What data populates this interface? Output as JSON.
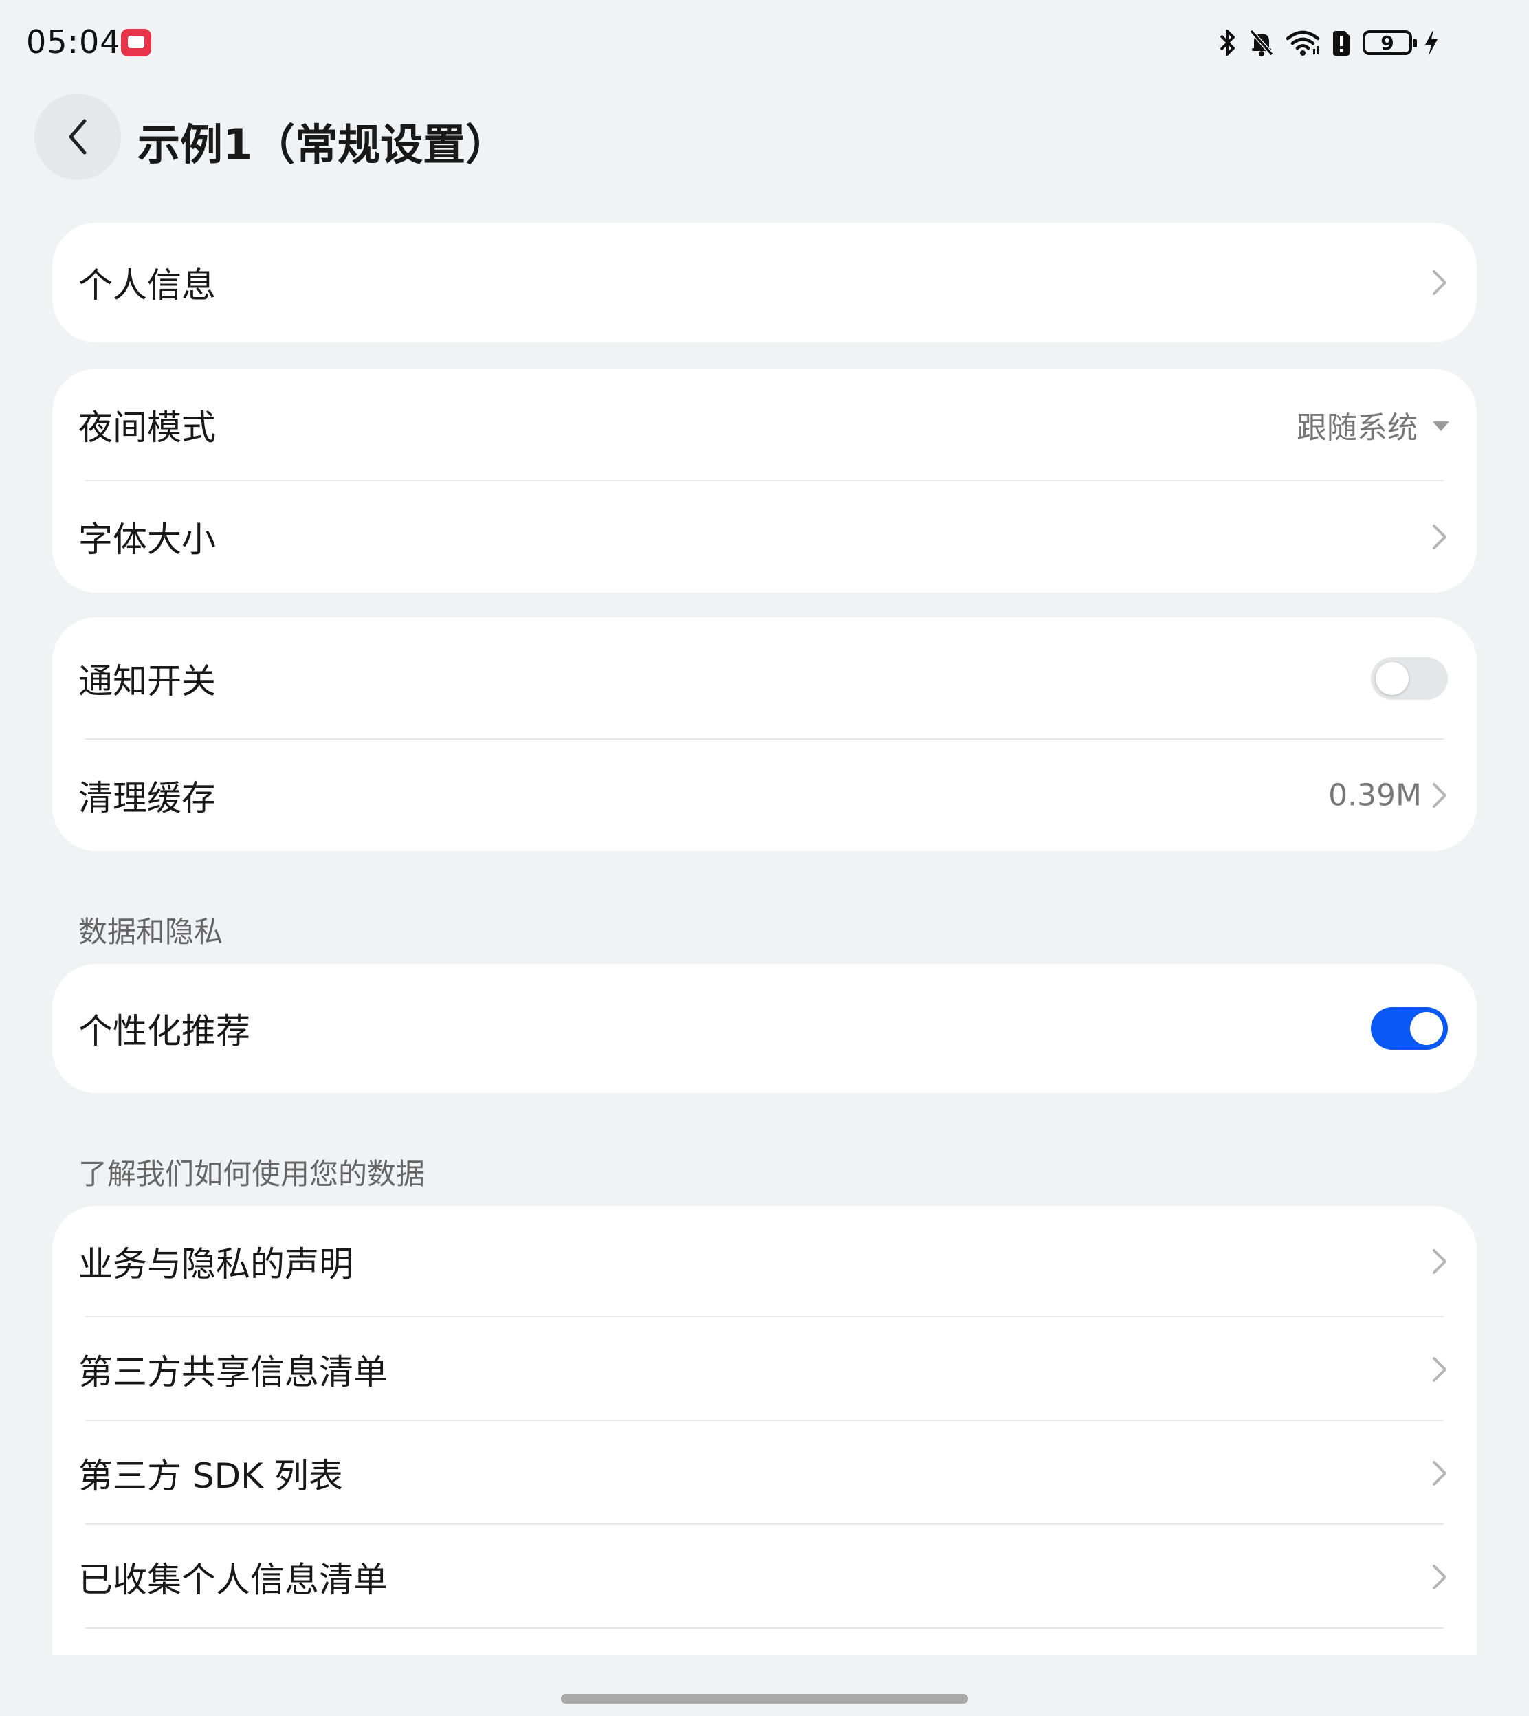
{
  "status_bar": {
    "time": "05:04",
    "battery_level": "9",
    "icons": [
      "bluetooth-icon",
      "mute-bell-icon",
      "wifi-icon",
      "sim-alert-icon",
      "battery-icon",
      "charging-icon"
    ]
  },
  "header": {
    "title": "示例1（常规设置）"
  },
  "groups": {
    "personal": {
      "label": "个人信息"
    },
    "display": {
      "night_mode": {
        "label": "夜间模式",
        "value": "跟随系统"
      },
      "font_size": {
        "label": "字体大小"
      }
    },
    "system": {
      "notifications": {
        "label": "通知开关",
        "enabled": false
      },
      "clear_cache": {
        "label": "清理缓存",
        "value": "0.39M"
      }
    },
    "privacy": {
      "section_label": "数据和隐私",
      "personalized": {
        "label": "个性化推荐",
        "enabled": true
      }
    },
    "data_usage": {
      "section_label": "了解我们如何使用您的数据",
      "items": [
        {
          "label": "业务与隐私的声明"
        },
        {
          "label": "第三方共享信息清单"
        },
        {
          "label": "第三方 SDK 列表"
        },
        {
          "label": "已收集个人信息清单"
        }
      ]
    }
  },
  "colors": {
    "accent": "#0a59f7",
    "background": "#f1f2f4",
    "card": "#ffffff",
    "text_primary": "#191919",
    "text_secondary": "#777777"
  }
}
